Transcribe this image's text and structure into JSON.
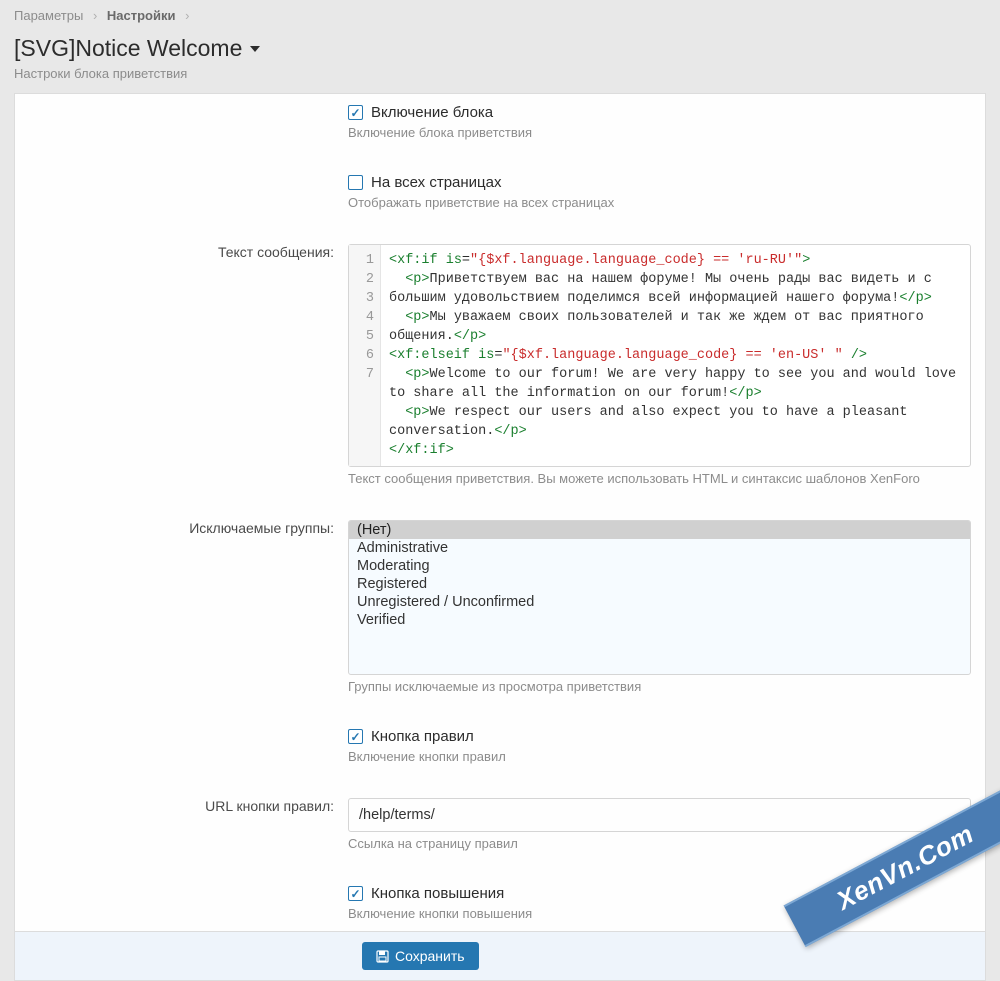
{
  "breadcrumb": {
    "item1": "Параметры",
    "item2": "Настройки"
  },
  "header": {
    "title": "[SVG]Notice Welcome",
    "subtitle": "Настроки блока приветствия"
  },
  "options": {
    "enable": {
      "label": "Включение блока",
      "hint": "Включение блока приветствия",
      "checked": true
    },
    "all_pages": {
      "label": "На всех страницах",
      "hint": "Отображать приветствие на всех страницах",
      "checked": false
    },
    "message": {
      "label": "Текст сообщения:",
      "hint": "Текст сообщения приветствия. Вы можете использовать HTML и синтаксис шаблонов XenForo",
      "code_lines": [
        {
          "n": "1",
          "html": "<span class='tag'>&lt;xf:if</span> <span class='attr'>is</span>=<span class='val'>\"{$xf.language.language_code} == 'ru-RU'\"</span><span class='tag'>&gt;</span>"
        },
        {
          "n": "2",
          "html": "&nbsp;&nbsp;<span class='tag'>&lt;p&gt;</span><span class='txt'>Приветствуем вас на нашем форуме! Мы очень рады вас видеть и с большим удовольствием поделимся всей информацией нашего форума!</span><span class='tag'>&lt;/p&gt;</span>"
        },
        {
          "n": "3",
          "html": "&nbsp;&nbsp;<span class='tag'>&lt;p&gt;</span><span class='txt'>Мы уважаем своих пользователей и так же ждем от вас приятного общения.</span><span class='tag'>&lt;/p&gt;</span>"
        },
        {
          "n": "4",
          "html": "<span class='tag'>&lt;xf:elseif</span> <span class='attr'>is</span>=<span class='val'>\"{$xf.language.language_code} == 'en-US' \"</span> <span class='tag'>/&gt;</span>"
        },
        {
          "n": "5",
          "html": "&nbsp;&nbsp;<span class='tag'>&lt;p&gt;</span><span class='txt'>Welcome to our forum! We are very happy to see you and would love to share all the information on our forum!</span><span class='tag'>&lt;/p&gt;</span>"
        },
        {
          "n": "6",
          "html": "&nbsp;&nbsp;<span class='tag'>&lt;p&gt;</span><span class='txt'>We respect our users and also expect you to have a pleasant conversation.</span><span class='tag'>&lt;/p&gt;</span>"
        },
        {
          "n": "7",
          "html": "<span class='tag'>&lt;/xf:if&gt;</span>"
        }
      ]
    },
    "excluded_groups": {
      "label": "Исключаемые группы:",
      "hint": "Группы исключаемые из просмотра приветствия",
      "items": [
        {
          "text": "(Нет)",
          "selected": true
        },
        {
          "text": "Administrative",
          "selected": false
        },
        {
          "text": "Moderating",
          "selected": false
        },
        {
          "text": "Registered",
          "selected": false
        },
        {
          "text": "Unregistered / Unconfirmed",
          "selected": false
        },
        {
          "text": "Verified",
          "selected": false
        }
      ]
    },
    "rules_button": {
      "label": "Кнопка правил",
      "hint": "Включение кнопки правил",
      "checked": true
    },
    "rules_url": {
      "label": "URL кнопки правил:",
      "value": "/help/terms/",
      "hint": "Ссылка на страницу правил"
    },
    "upgrade_button": {
      "label": "Кнопка повышения",
      "hint": "Включение кнопки повышения",
      "checked": true
    }
  },
  "footer": {
    "save": "Сохранить"
  },
  "watermark": "XenVn.Com"
}
